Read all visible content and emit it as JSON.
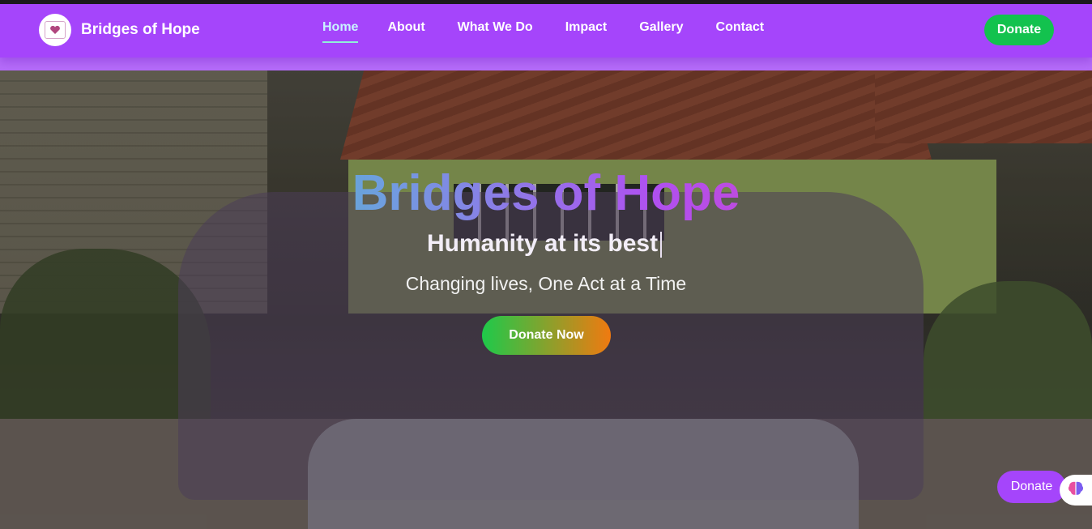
{
  "brand": {
    "name": "Bridges of Hope",
    "logo_icon": "heart-logo-icon"
  },
  "nav": {
    "items": [
      {
        "label": "Home",
        "active": true
      },
      {
        "label": "About",
        "active": false
      },
      {
        "label": "What We Do",
        "active": false
      },
      {
        "label": "Impact",
        "active": false
      },
      {
        "label": "Gallery",
        "active": false
      },
      {
        "label": "Contact",
        "active": false
      }
    ],
    "donate_label": "Donate"
  },
  "hero": {
    "title": "Bridges of Hope",
    "tagline": "Humanity at its best",
    "subtitle": "Changing lives, One Act at a Time",
    "cta_label": "Donate Now"
  },
  "floating": {
    "donate_label": "Donate",
    "assistant_icon": "brain-icon"
  },
  "colors": {
    "nav_bg": "#a545fb",
    "donate_green": "#13c24e",
    "cta_gradient_start": "#1ec94a",
    "cta_gradient_end": "#f07a10",
    "active_underline": "#8ff0d9"
  }
}
